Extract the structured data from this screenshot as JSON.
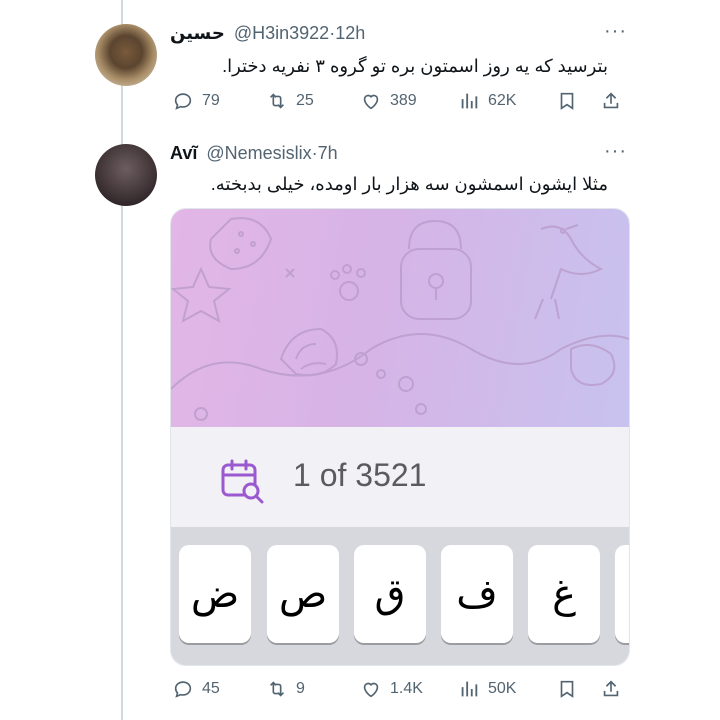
{
  "tweets": [
    {
      "name": "حسين",
      "handle": "@H3in3922",
      "time": "12h",
      "more": "···",
      "text": "بترسید که یه روز اسمتون بره تو گروه ۳ نفریه دخترا.",
      "replies": "79",
      "reposts": "25",
      "likes": "389",
      "views": "62K"
    },
    {
      "name": "Avĩ",
      "handle": "@Nemesislix",
      "time": "7h",
      "more": "···",
      "text": "مثلا ایشون اسمشون سه هزار بار اومده، خیلی بدبخته.",
      "media": {
        "search_counter": "1 of 3521",
        "keys": [
          "ض",
          "ص",
          "ق",
          "ف",
          "غ"
        ]
      },
      "replies": "45",
      "reposts": "9",
      "likes": "1.4K",
      "views": "50K"
    }
  ],
  "icons": {
    "reply": "reply-icon",
    "repost": "repost-icon",
    "like": "like-icon",
    "views": "views-icon",
    "bookmark": "bookmark-icon",
    "share": "share-icon",
    "calendar_search": "calendar-search-icon"
  },
  "colors": {
    "text": "#0f1419",
    "secondary": "#536471",
    "calendar_icon": "#9b59d0"
  }
}
